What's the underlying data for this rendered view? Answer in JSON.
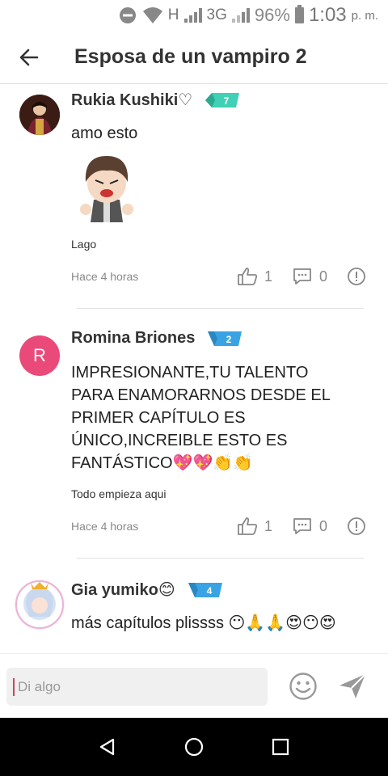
{
  "status_bar": {
    "network_h": "H",
    "network_3g": "3G",
    "battery": "96%",
    "time": "1:03",
    "ampm": "p. m."
  },
  "header": {
    "title": "Esposa de un vampiro 2",
    "back_icon": "arrow-left-icon"
  },
  "comments": [
    {
      "author": "Rukia Kushiki♡",
      "level": "7",
      "text": "amo esto",
      "source": "Lago",
      "time_ago": "Hace 4 horas",
      "likes": "1",
      "replies": "0"
    },
    {
      "author": "Romina Briones",
      "avatar_letter": "R",
      "avatar_color": "#e94a7a",
      "level": "2",
      "text": "IMPRESIONANTE,TU TALENTO PARA ENAMORARNOS DESDE EL PRIMER CAPÍTULO ES ÚNICO,INCREIBLE ESTO ES FANTÁSTICO💖💖👏👏",
      "source": "Todo empieza aqui",
      "time_ago": "Hace 4 horas",
      "likes": "1",
      "replies": "0"
    },
    {
      "author": "Gia yumiko😊",
      "level": "4",
      "text": "más capítulos plissss 😶🙏🙏😍😶😍"
    }
  ],
  "input": {
    "placeholder": "Di algo"
  },
  "colors": {
    "badge_teal": "#3fd0b5",
    "badge_blue": "#3aa3e3",
    "accent": "#d0415e"
  }
}
